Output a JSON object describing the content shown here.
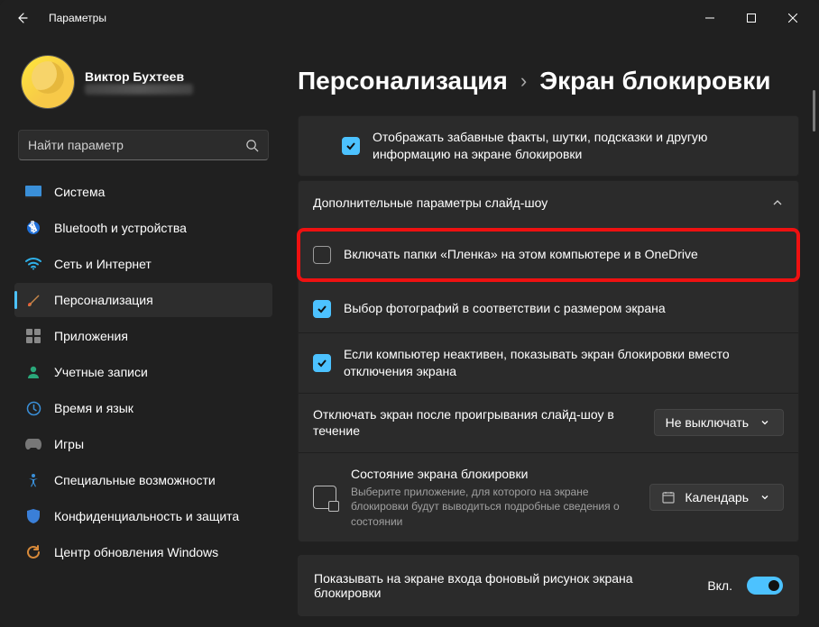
{
  "titlebar": {
    "title": "Параметры"
  },
  "user": {
    "name": "Виктор Бухтеев"
  },
  "search": {
    "placeholder": "Найти параметр"
  },
  "nav": {
    "system": "Система",
    "bluetooth": "Bluetooth и устройства",
    "network": "Сеть и Интернет",
    "personalization": "Персонализация",
    "apps": "Приложения",
    "accounts": "Учетные записи",
    "time": "Время и язык",
    "gaming": "Игры",
    "accessibility": "Специальные возможности",
    "privacy": "Конфиденциальность и защита",
    "update": "Центр обновления Windows"
  },
  "breadcrumb": {
    "a": "Персонализация",
    "b": "Экран блокировки"
  },
  "rows": {
    "funfacts": "Отображать забавные факты, шутки, подсказки и другую информацию на экране блокировки",
    "expander": "Дополнительные параметры слайд-шоу",
    "camera_roll": "Включать папки «Пленка» на этом компьютере и в OneDrive",
    "fit": "Выбор фотографий в соответствии с размером экрана",
    "inactive": "Если компьютер неактивен, показывать экран блокировки вместо отключения экрана",
    "turnoff_label": "Отключать экран после проигрывания слайд-шоу в течение",
    "turnoff_value": "Не выключать",
    "status_title": "Состояние экрана блокировки",
    "status_sub": "Выберите приложение, для которого на экране блокировки будут выводиться подробные сведения о состоянии",
    "status_value": "Календарь",
    "signin_bg": "Показывать на экране входа фоновый рисунок экрана блокировки",
    "on": "Вкл."
  }
}
